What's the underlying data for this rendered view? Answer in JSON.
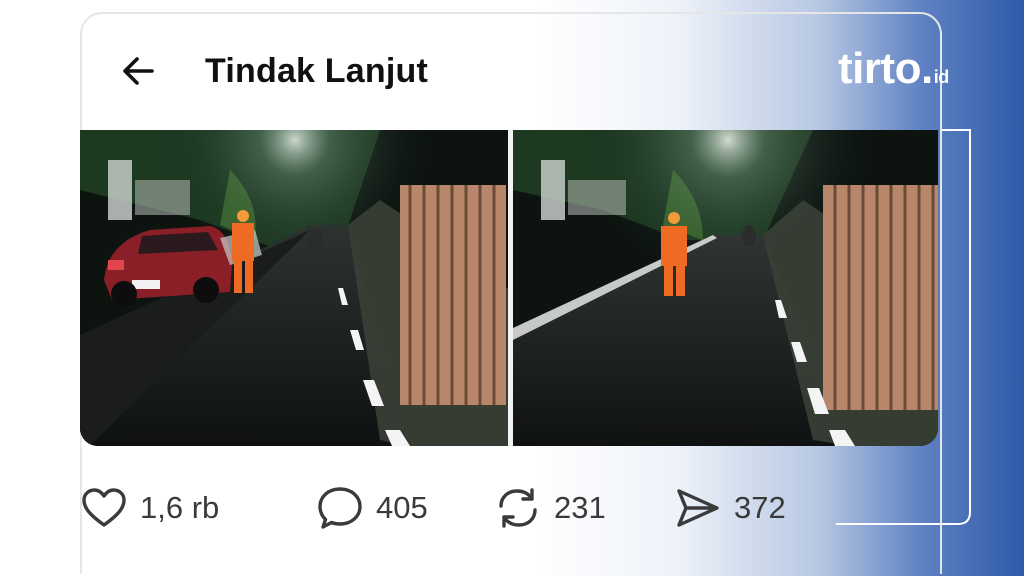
{
  "header": {
    "back_icon": "arrow-left-icon",
    "title": "Tindak Lanjut"
  },
  "photos": [
    {
      "icon": "photo-night-street-with-car-and-worker"
    },
    {
      "icon": "photo-night-street-with-worker"
    }
  ],
  "actions": {
    "like": {
      "icon": "heart-icon",
      "count": "1,6 rb"
    },
    "reply": {
      "icon": "comment-icon",
      "count": "405"
    },
    "repost": {
      "icon": "repost-icon",
      "count": "231"
    },
    "share": {
      "icon": "send-icon",
      "count": "372"
    }
  },
  "brand": {
    "name": "tirto",
    "tld": "id",
    "colors": {
      "blue": "#2e5aa8",
      "white": "#ffffff"
    }
  }
}
